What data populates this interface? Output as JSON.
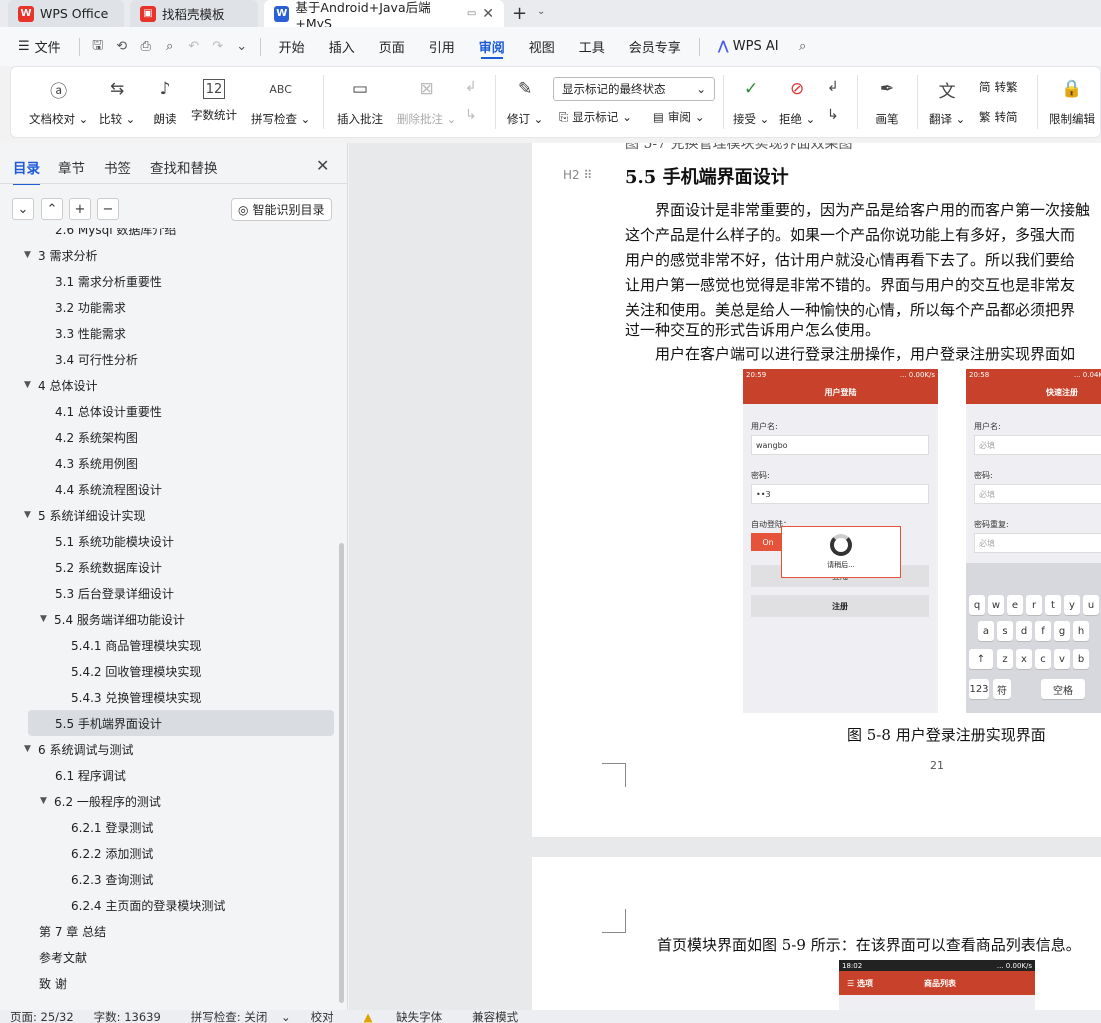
{
  "tabs": [
    {
      "label": "WPS Office",
      "icon": "wps-logo-icon"
    },
    {
      "label": "找稻壳模板",
      "icon": "docer-icon"
    },
    {
      "label": "基于Android+Java后端+MyS",
      "icon": "word-doc-icon"
    }
  ],
  "menubar": {
    "file": "文件",
    "items": [
      "开始",
      "插入",
      "页面",
      "引用",
      "审阅",
      "视图",
      "工具",
      "会员专享"
    ],
    "active": "审阅",
    "wps_ai": "WPS AI"
  },
  "ribbon": {
    "doc_check": "文档校对",
    "compare": "比较",
    "read_aloud": "朗读",
    "word_count": "字数统计",
    "spell_check": "拼写检查",
    "insert_comment": "插入批注",
    "delete_comment": "删除批注",
    "revise": "修订",
    "markup_state": "显示标记的最终状态",
    "show_markup": "显示标记",
    "review": "审阅",
    "accept": "接受",
    "reject": "拒绝",
    "pen": "画笔",
    "translate": "翻译",
    "to_traditional": "转繁",
    "to_simplified": "转简",
    "restrict_edit": "限制编辑",
    "word_count_icon": "12",
    "spell_icon": "ABC"
  },
  "panel": {
    "tabs": [
      "目录",
      "章节",
      "书签",
      "查找和替换"
    ],
    "smart_toc": "智能识别目录",
    "toc": [
      {
        "label": "2.6 Mysql 数据库介绍",
        "level": 1,
        "expand": ""
      },
      {
        "label": "3 需求分析",
        "level": 0,
        "expand": "▼"
      },
      {
        "label": "3.1 需求分析重要性",
        "level": 1,
        "expand": ""
      },
      {
        "label": "3.2 功能需求",
        "level": 1,
        "expand": ""
      },
      {
        "label": "3.3 性能需求",
        "level": 1,
        "expand": ""
      },
      {
        "label": "3.4 可行性分析",
        "level": 1,
        "expand": ""
      },
      {
        "label": "4 总体设计",
        "level": 0,
        "expand": "▼"
      },
      {
        "label": "4.1 总体设计重要性",
        "level": 1,
        "expand": ""
      },
      {
        "label": "4.2 系统架构图",
        "level": 1,
        "expand": ""
      },
      {
        "label": "4.3 系统用例图",
        "level": 1,
        "expand": ""
      },
      {
        "label": "4.4 系统流程图设计",
        "level": 1,
        "expand": ""
      },
      {
        "label": "5 系统详细设计实现",
        "level": 0,
        "expand": "▼"
      },
      {
        "label": "5.1 系统功能模块设计",
        "level": 1,
        "expand": ""
      },
      {
        "label": "5.2 系统数据库设计",
        "level": 1,
        "expand": ""
      },
      {
        "label": "5.3 后台登录详细设计",
        "level": 1,
        "expand": ""
      },
      {
        "label": "5.4 服务端详细功能设计",
        "level": 1,
        "expand": "▼"
      },
      {
        "label": "5.4.1 商品管理模块实现",
        "level": 2,
        "expand": ""
      },
      {
        "label": "5.4.2 回收管理模块实现",
        "level": 2,
        "expand": ""
      },
      {
        "label": "5.4.3 兑换管理模块实现",
        "level": 2,
        "expand": ""
      },
      {
        "label": "5.5 手机端界面设计",
        "level": 1,
        "expand": "",
        "selected": true
      },
      {
        "label": "6 系统调试与测试",
        "level": 0,
        "expand": "▼"
      },
      {
        "label": "6.1 程序调试",
        "level": 1,
        "expand": ""
      },
      {
        "label": "6.2 一般程序的测试",
        "level": 1,
        "expand": "▼"
      },
      {
        "label": "6.2.1 登录测试",
        "level": 2,
        "expand": ""
      },
      {
        "label": "6.2.2 添加测试",
        "level": 2,
        "expand": ""
      },
      {
        "label": "6.2.3 查询测试",
        "level": 2,
        "expand": ""
      },
      {
        "label": "6.2.4 主页面的登录模块测试",
        "level": 2,
        "expand": ""
      },
      {
        "label": "第 7 章 总结",
        "level": 0,
        "expand": ""
      },
      {
        "label": "参考文献",
        "level": 0,
        "expand": ""
      },
      {
        "label": "致 谢",
        "level": 0,
        "expand": ""
      }
    ]
  },
  "document": {
    "prev_caption": "图 5-7 兑换管理模块实现界面效果图",
    "heading": "5.5  手机端界面设计",
    "heading_marker": "H2",
    "lines": [
      "界面设计是非常重要的，因为产品是给客户用的而客户第一次接触",
      "这个产品是什么样子的。如果一个产品你说功能上有多好，多强大而",
      "用户的感觉非常不好，估计用户就没心情再看下去了。所以我们要给",
      "让用户第一感觉也觉得是非常不错的。界面与用户的交互也是非常友",
      "关注和使用。美总是给人一种愉快的心情，所以每个产品都必须把界",
      "过一种交互的形式告诉用户怎么使用。"
    ],
    "line2": "用户在客户端可以进行登录注册操作，用户登录注册实现界面如",
    "figure_caption": "图 5-8 用户登录注册实现界面",
    "page_number": "21",
    "next_page_line": "首页模块界面如图 5-9 所示：在该界面可以查看商品列表信息。"
  },
  "phone_login": {
    "time": "20:59",
    "speed": "... 0.00K/s",
    "title": "用户登陆",
    "user_label": "用户名:",
    "user_value": "wangbo",
    "pwd_label": "密码:",
    "pwd_value": "••3",
    "auto_label": "自动登陆：",
    "toggle": "On",
    "loading": "请稍后...",
    "login_btn": "登陆",
    "register_btn": "注册"
  },
  "phone_register": {
    "time": "20:58",
    "speed": "... 0.04K/s",
    "title": "快速注册",
    "user_label": "用户名:",
    "pwd_label": "密码:",
    "pwd2_label": "密码重复:",
    "placeholder": "必填",
    "keys_row1": [
      "q",
      "w",
      "e",
      "r",
      "t",
      "y",
      "u"
    ],
    "keys_row2": [
      "a",
      "s",
      "d",
      "f",
      "g",
      "h"
    ],
    "keys_row3": [
      "z",
      "x",
      "c",
      "v",
      "b"
    ],
    "key_123": "123",
    "key_sym": "符",
    "key_space": "空格"
  },
  "phone_home": {
    "time": "18:02",
    "speed": "... 0.00K/s",
    "menu": "选项",
    "title": "商品列表"
  },
  "status": {
    "page": "页面: 25/32",
    "words": "字数: 13639",
    "spell": "拼写检查: 关闭",
    "proof": "校对",
    "missing_font": "缺失字体",
    "compat": "兼容模式"
  }
}
